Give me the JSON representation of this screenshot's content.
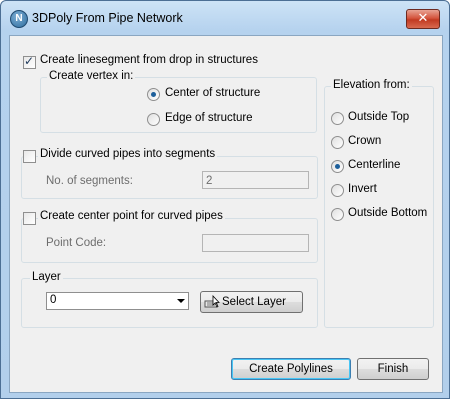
{
  "window": {
    "title": "3DPoly From Pipe Network",
    "close_glyph": "✕",
    "app_icon_letter": "N"
  },
  "linesegment": {
    "checkbox_label": "Create linesegment from drop in structures",
    "checked": true,
    "vertex_group_title": "Create vertex in:",
    "options": [
      {
        "label": "Center of structure",
        "selected": true
      },
      {
        "label": "Edge of structure",
        "selected": false
      }
    ]
  },
  "divide": {
    "checkbox_label": "Divide curved pipes into segments",
    "checked": false,
    "segments_label": "No. of segments:",
    "segments_value": "2"
  },
  "center_point": {
    "checkbox_label": "Create center point for curved pipes",
    "checked": false,
    "point_code_label": "Point Code:",
    "point_code_value": ""
  },
  "layer": {
    "group_title": "Layer",
    "selected_value": "0",
    "select_button_label": "Select Layer",
    "select_button_icon": "select-layer-icon"
  },
  "elevation": {
    "group_title": "Elevation from:",
    "options": [
      {
        "label": "Outside Top",
        "selected": false
      },
      {
        "label": "Crown",
        "selected": false
      },
      {
        "label": "Centerline",
        "selected": true
      },
      {
        "label": "Invert",
        "selected": false
      },
      {
        "label": "Outside Bottom",
        "selected": false
      }
    ]
  },
  "buttons": {
    "create_label": "Create Polylines",
    "finish_label": "Finish"
  }
}
